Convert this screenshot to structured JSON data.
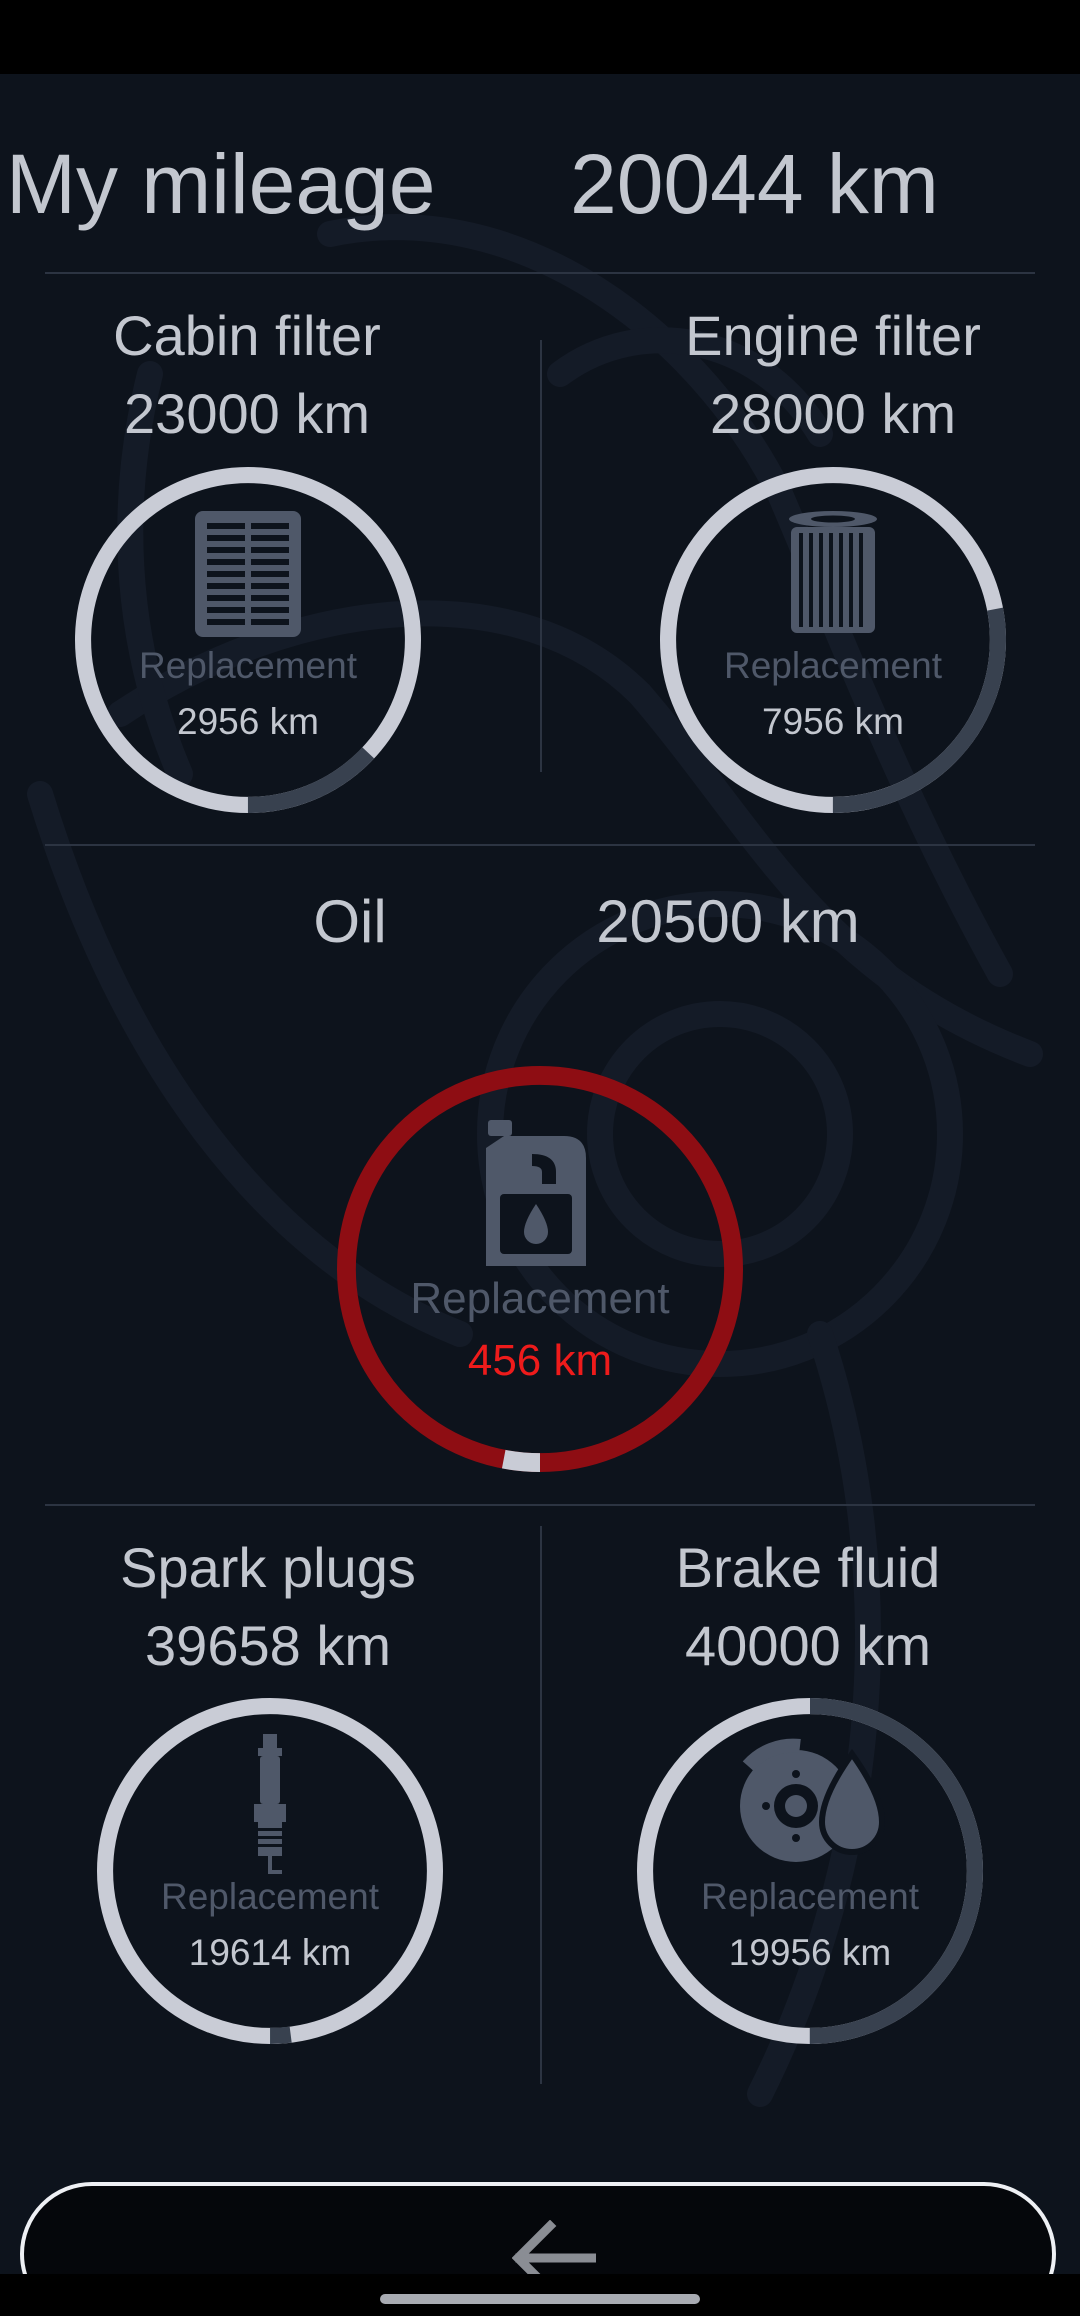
{
  "header": {
    "label": "My mileage",
    "value": "20044 km"
  },
  "common": {
    "replacement_label": "Replacement"
  },
  "items": {
    "cabin_filter": {
      "title": "Cabin filter",
      "interval": "23000 km",
      "remaining": "2956 km",
      "remaining_fraction": 0.13,
      "icon": "cabin-filter-icon",
      "status": "normal"
    },
    "engine_filter": {
      "title": "Engine filter",
      "interval": "28000 km",
      "remaining": "7956 km",
      "remaining_fraction": 0.28,
      "icon": "engine-filter-icon",
      "status": "normal"
    },
    "oil": {
      "title": "Oil",
      "interval": "20500 km",
      "remaining": "456 km",
      "remaining_fraction": 0.03,
      "icon": "oil-canister-icon",
      "status": "warning"
    },
    "spark_plugs": {
      "title": "Spark plugs",
      "interval": "39658 km",
      "remaining": "19614 km",
      "remaining_fraction": 0.02,
      "icon": "spark-plug-icon",
      "status": "normal"
    },
    "brake_fluid": {
      "title": "Brake fluid",
      "interval": "40000 km",
      "remaining": "19956 km",
      "remaining_fraction": 0.5,
      "icon": "brake-disc-fluid-icon",
      "status": "normal"
    }
  },
  "colors": {
    "background": "#0d131c",
    "ring_used": "#c9ccd6",
    "ring_remaining": "#38414f",
    "ring_warning": "#8e0d13",
    "warning_text": "#ee1b1b",
    "text": "#c3c7cf",
    "muted_text": "#4f5869",
    "icon": "#4f5869"
  },
  "navigation": {
    "back_icon": "arrow-left-icon"
  }
}
